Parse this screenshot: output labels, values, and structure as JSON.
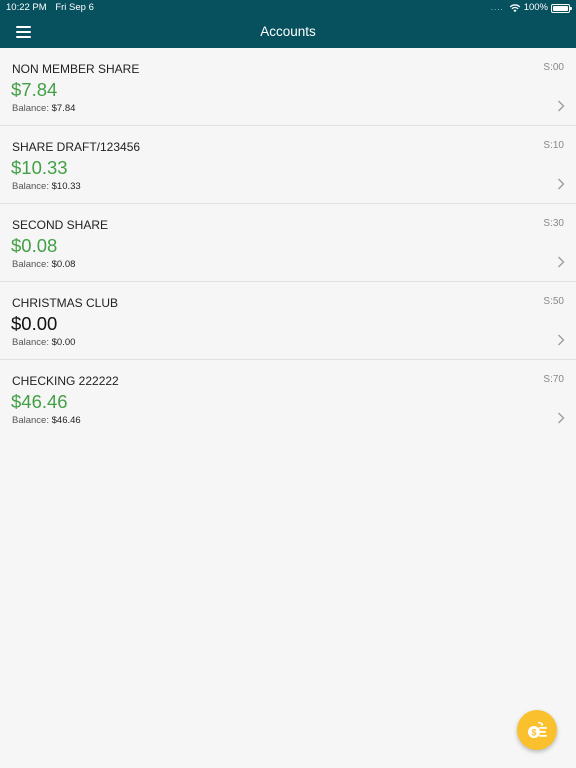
{
  "status_bar": {
    "time": "10:22 PM",
    "date": "Fri Sep 6",
    "signal": "....",
    "battery_percent": "100%",
    "icons": [
      "wifi-icon",
      "battery-icon"
    ]
  },
  "nav": {
    "title": "Accounts",
    "menu_icon": "hamburger-menu-icon"
  },
  "colors": {
    "header_bg": "#07505e",
    "positive_amount": "#43a047",
    "zero_amount": "#111111",
    "fab_bg": "#fbc02d",
    "background": "#f6f6f6"
  },
  "accounts": [
    {
      "name": "NON MEMBER SHARE",
      "suffix": "S:00",
      "available": "$7.84",
      "balance_label": "Balance:",
      "balance": "$7.84",
      "positive": true
    },
    {
      "name": "SHARE DRAFT/123456",
      "suffix": "S:10",
      "available": "$10.33",
      "balance_label": "Balance:",
      "balance": "$10.33",
      "positive": true
    },
    {
      "name": "SECOND SHARE",
      "suffix": "S:30",
      "available": "$0.08",
      "balance_label": "Balance:",
      "balance": "$0.08",
      "positive": true
    },
    {
      "name": "CHRISTMAS CLUB",
      "suffix": "S:50",
      "available": "$0.00",
      "balance_label": "Balance:",
      "balance": "$0.00",
      "positive": false
    },
    {
      "name": "CHECKING 222222",
      "suffix": "S:70",
      "available": "$46.46",
      "balance_label": "Balance:",
      "balance": "$46.46",
      "positive": true
    }
  ],
  "fab": {
    "icon": "transfer-coin-icon"
  }
}
